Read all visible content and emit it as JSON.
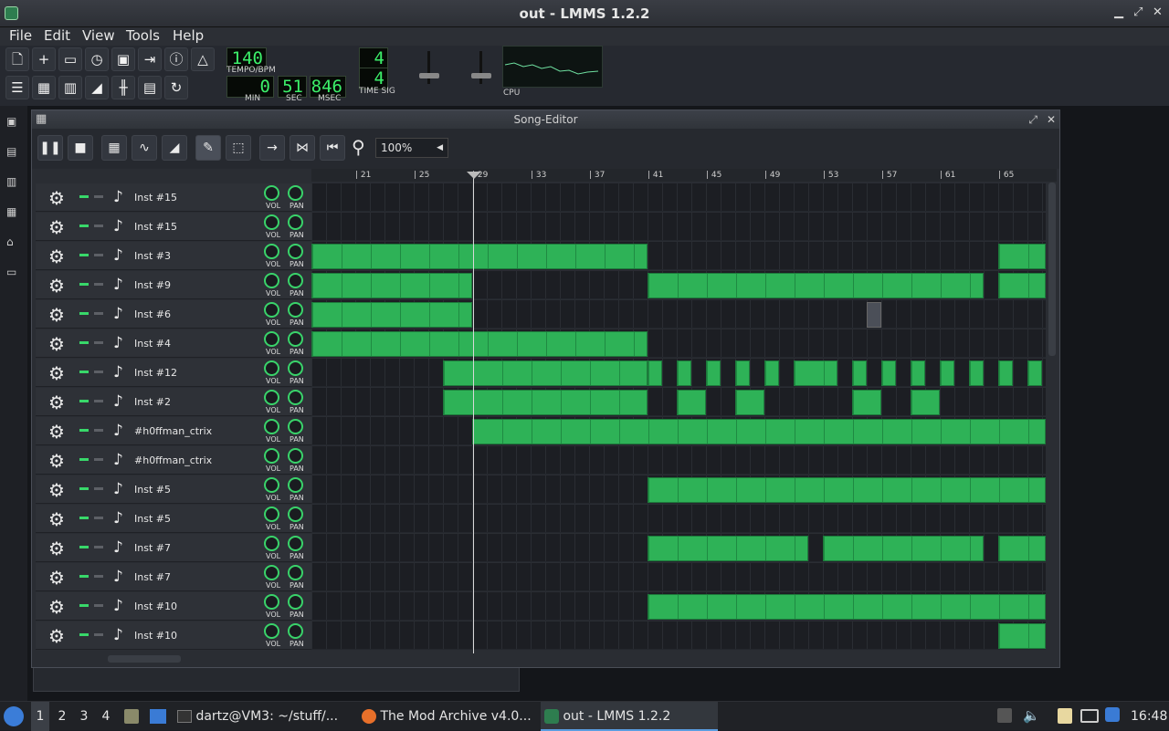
{
  "window": {
    "title": "out - LMMS 1.2.2"
  },
  "menu": [
    "File",
    "Edit",
    "View",
    "Tools",
    "Help"
  ],
  "transport": {
    "tempo": "140",
    "tempo_label": "TEMPO/BPM",
    "min": "0",
    "sec": "51",
    "msec": "846",
    "min_label": "MIN",
    "sec_label": "SEC",
    "msec_label": "MSEC",
    "timesig_num": "4",
    "timesig_den": "4",
    "timesig_label": "TIME SIG",
    "cpu_label": "CPU"
  },
  "song_editor": {
    "title": "Song-Editor",
    "zoom": "100%",
    "ruler": [
      "21",
      "25",
      "29",
      "33",
      "37",
      "41",
      "45",
      "49",
      "53",
      "57",
      "61",
      "65"
    ],
    "vol_label": "VOL",
    "pan_label": "PAN",
    "tracks": [
      {
        "name": "Inst #15"
      },
      {
        "name": "Inst #15"
      },
      {
        "name": "Inst #3"
      },
      {
        "name": "Inst #9"
      },
      {
        "name": "Inst #6"
      },
      {
        "name": "Inst #4"
      },
      {
        "name": "Inst #12"
      },
      {
        "name": "Inst #2"
      },
      {
        "name": "#h0ffman_ctrix"
      },
      {
        "name": "#h0ffman_ctrix"
      },
      {
        "name": "Inst #5"
      },
      {
        "name": "Inst #5"
      },
      {
        "name": "Inst #7"
      },
      {
        "name": "Inst #7"
      },
      {
        "name": "Inst #10"
      },
      {
        "name": "Inst #10"
      }
    ]
  },
  "taskbar": {
    "workspaces": [
      "1",
      "2",
      "3",
      "4"
    ],
    "tasks": [
      "dartz@VM3: ~/stuff/...",
      "The Mod Archive v4.0...",
      "out - LMMS 1.2.2"
    ],
    "clock": "16:48"
  },
  "colors": {
    "pattern": "#2eb257",
    "lcd": "#3cf06a",
    "accent": "#39d36a"
  }
}
